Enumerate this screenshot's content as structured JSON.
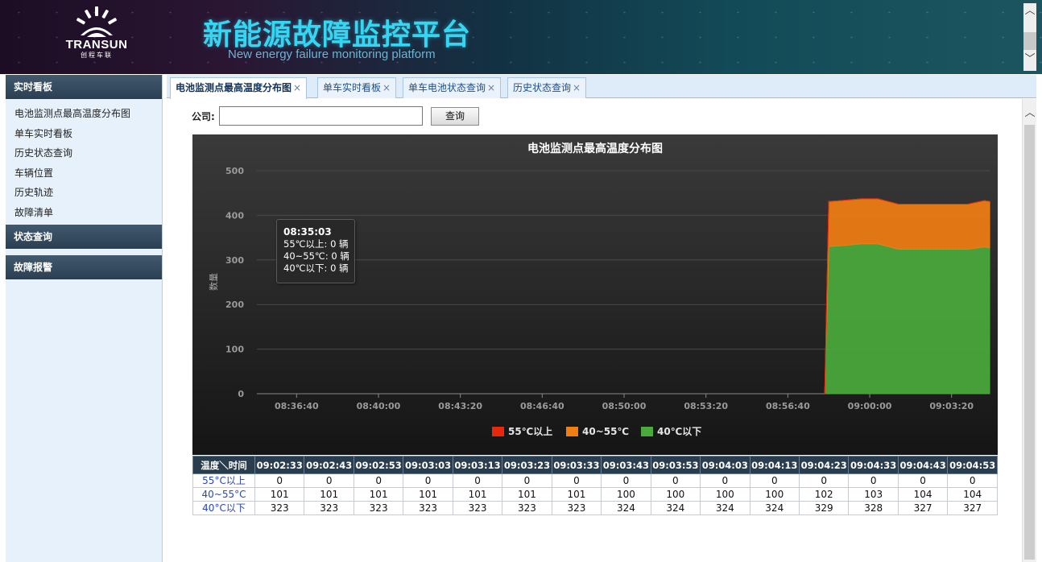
{
  "header": {
    "brand": "TRANSUN",
    "brand_cn": "创程车联",
    "title_cn": "新能源故障监控平台",
    "title_en": "New energy failure monitoring platform"
  },
  "sidebar": {
    "sections": [
      {
        "label": "实时看板",
        "items": [
          "电池监测点最高温度分布图",
          "单车实时看板",
          "历史状态查询",
          "车辆位置",
          "历史轨迹",
          "故障清单"
        ]
      },
      {
        "label": "状态查询",
        "items": []
      },
      {
        "label": "故障报警",
        "items": []
      }
    ]
  },
  "tabs": [
    {
      "label": "电池监测点最高温度分布图",
      "active": true
    },
    {
      "label": "单车实时看板",
      "active": false
    },
    {
      "label": "单车电池状态查询",
      "active": false
    },
    {
      "label": "历史状态查询",
      "active": false
    }
  ],
  "tab_close": "×",
  "search": {
    "label": "公司:",
    "value": "",
    "button": "查询"
  },
  "tooltip": {
    "time": "08:35:03",
    "lines": [
      "55℃以上: 0 辆",
      "40~55℃: 0 辆",
      "40℃以下: 0 辆"
    ]
  },
  "chart_data": {
    "type": "area",
    "title": "电池监测点最高温度分布图",
    "ylabel": "数量",
    "xlabel": "",
    "ylim": [
      0,
      500
    ],
    "yticks": [
      0,
      100,
      200,
      300,
      400,
      500
    ],
    "xticks": [
      "08:36:40",
      "08:40:00",
      "08:43:20",
      "08:46:40",
      "08:50:00",
      "08:53:20",
      "08:56:40",
      "09:00:00",
      "09:03:20"
    ],
    "x": [
      "08:58:20",
      "08:58:50",
      "08:59:40",
      "09:00:20",
      "09:01:10",
      "09:02:00",
      "09:02:50",
      "09:03:20",
      "09:04:00",
      "09:04:40",
      "09:04:53"
    ],
    "stacked": true,
    "series": [
      {
        "name": "55℃以上",
        "color": "#e8280c",
        "values": [
          0,
          0,
          0,
          0,
          0,
          0,
          0,
          0,
          0,
          0,
          0
        ]
      },
      {
        "name": "40~55℃",
        "color": "#f07e12",
        "values": [
          101,
          101,
          101,
          101,
          101,
          101,
          101,
          101,
          101,
          104,
          104
        ]
      },
      {
        "name": "40℃以下",
        "color": "#4aaa3c",
        "values": [
          330,
          332,
          336,
          336,
          324,
          324,
          324,
          324,
          324,
          329,
          327
        ]
      }
    ],
    "legend_position": "bottom",
    "grid": true,
    "background": "#1e1e1e"
  },
  "table": {
    "corner": "温度＼时间",
    "times": [
      "09:02:33",
      "09:02:43",
      "09:02:53",
      "09:03:03",
      "09:03:13",
      "09:03:23",
      "09:03:33",
      "09:03:43",
      "09:03:53",
      "09:04:03",
      "09:04:13",
      "09:04:23",
      "09:04:33",
      "09:04:43",
      "09:04:53"
    ],
    "rows": [
      {
        "label": "55°C以上",
        "values": [
          "0",
          "0",
          "0",
          "0",
          "0",
          "0",
          "0",
          "0",
          "0",
          "0",
          "0",
          "0",
          "0",
          "0",
          "0"
        ]
      },
      {
        "label": "40~55°C",
        "values": [
          "101",
          "101",
          "101",
          "101",
          "101",
          "101",
          "101",
          "100",
          "100",
          "100",
          "100",
          "102",
          "103",
          "104",
          "104"
        ]
      },
      {
        "label": "40°C以下",
        "values": [
          "323",
          "323",
          "323",
          "323",
          "323",
          "323",
          "323",
          "324",
          "324",
          "324",
          "324",
          "329",
          "328",
          "327",
          "327"
        ]
      }
    ]
  }
}
